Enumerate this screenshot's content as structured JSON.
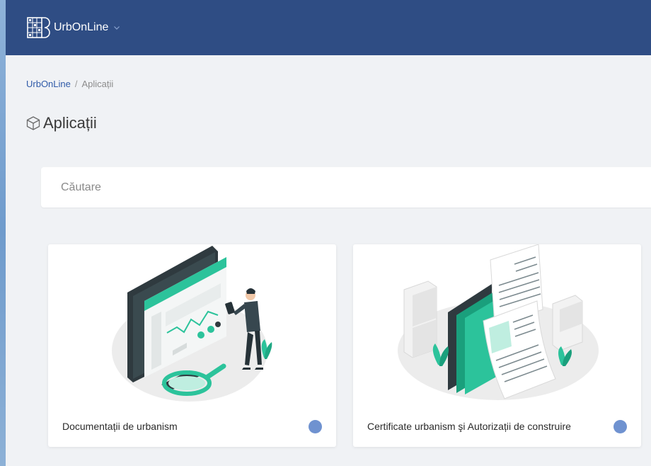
{
  "header": {
    "app_name": "UrbOnLine",
    "logo_icon": "building-logo-icon",
    "menu_icon": "chevron-down-icon"
  },
  "breadcrumb": {
    "root": "UrbOnLine",
    "separator": "/",
    "current": "Aplicații"
  },
  "page": {
    "title": "Aplicații",
    "title_icon": "cube-icon"
  },
  "search": {
    "placeholder": "Căutare",
    "value": ""
  },
  "cards": [
    {
      "title": "Documentații de urbanism",
      "status_color": "#6f92d0"
    },
    {
      "title": "Certificate urbanism şi Autorizații de construire",
      "status_color": "#6f92d0"
    }
  ],
  "colors": {
    "topbar": "#2f4d84",
    "background": "#f0f2f5",
    "accent": "#1fc49a",
    "link": "#2f5aa8"
  }
}
